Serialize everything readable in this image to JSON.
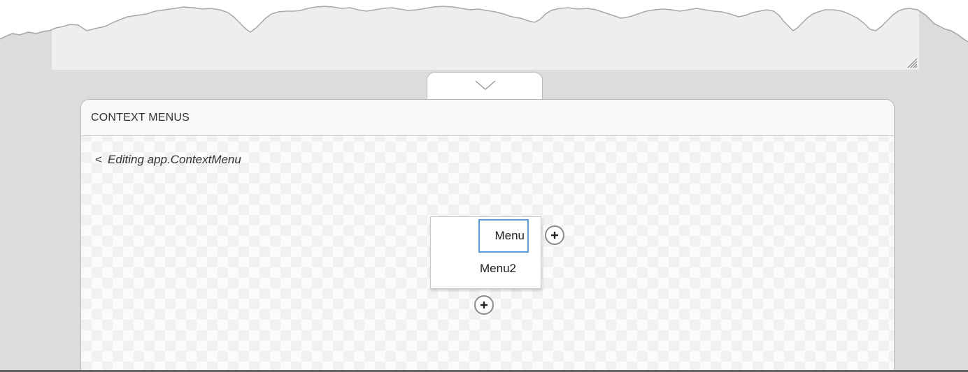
{
  "panel": {
    "title": "CONTEXT MENUS",
    "breadcrumb": {
      "back_icon": "<",
      "text": "Editing app.ContextMenu"
    }
  },
  "menu": {
    "items": [
      {
        "label": "Menu",
        "editing": true
      },
      {
        "label": "Menu2",
        "editing": false
      }
    ]
  },
  "icons": {
    "collapse": "chevron-down-icon",
    "add": "plus-icon",
    "resize": "resize-grip-icon"
  },
  "colors": {
    "accent": "#5b9bd5",
    "frame": "#dcdcdc",
    "canvas": "#eeeeee",
    "panel_border": "#b8b8b8"
  }
}
